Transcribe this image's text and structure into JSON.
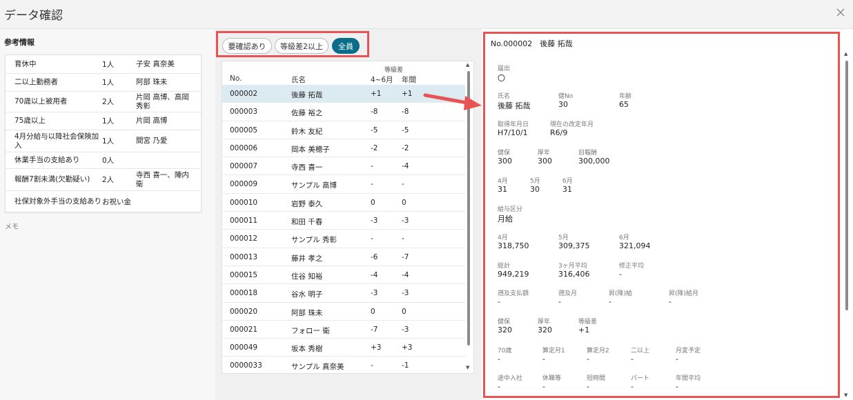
{
  "window": {
    "title": "データ確認"
  },
  "reference": {
    "heading": "参考情報",
    "rows": [
      {
        "label": "育休中",
        "count": "1人",
        "names": "子安 真奈美"
      },
      {
        "label": "二以上勤務者",
        "count": "1人",
        "names": "阿部 珠未"
      },
      {
        "label": "70歳以上被用者",
        "count": "2人",
        "names": "片岡 高博、高岡 秀彰"
      },
      {
        "label": "75歳以上",
        "count": "1人",
        "names": "片岡 高博"
      },
      {
        "label": "4月分給与以降社会保険加入",
        "count": "1人",
        "names": "間宮 乃愛"
      },
      {
        "label": "休業手当の支給あり",
        "count": "0人",
        "names": ""
      },
      {
        "label": "報酬7割未満(欠勤疑い)",
        "count": "2人",
        "names": "寺西 喜一、陣内 衛"
      },
      {
        "label": "社保対象外手当の支給あり",
        "count": "お祝い金",
        "names": ""
      }
    ],
    "memo_label": "メモ"
  },
  "filters": {
    "items": [
      "要確認あり",
      "等級差2以上",
      "全員"
    ],
    "active": "全員"
  },
  "list": {
    "header": {
      "group": "等級差",
      "no": "No.",
      "name": "氏名",
      "col_a": "4~6月",
      "col_b": "年間"
    },
    "rows": [
      {
        "no": "000002",
        "name": "後藤 拓哉",
        "a": "+1",
        "b": "+1",
        "selected": true
      },
      {
        "no": "000003",
        "name": "佐藤 裕之",
        "a": "-8",
        "b": "-8"
      },
      {
        "no": "000005",
        "name": "鈴木 友紀",
        "a": "-5",
        "b": "-5"
      },
      {
        "no": "000006",
        "name": "岡本 美穂子",
        "a": "-2",
        "b": "-2"
      },
      {
        "no": "000007",
        "name": "寺西 喜一",
        "a": "-",
        "b": "-4"
      },
      {
        "no": "000009",
        "name": "サンプル 高博",
        "a": "-",
        "b": "-"
      },
      {
        "no": "000010",
        "name": "岩野 泰久",
        "a": "0",
        "b": "0"
      },
      {
        "no": "000011",
        "name": "和田 千春",
        "a": "-3",
        "b": "-3"
      },
      {
        "no": "000012",
        "name": "サンプル 秀彰",
        "a": "-",
        "b": "-"
      },
      {
        "no": "000013",
        "name": "藤井 孝之",
        "a": "-6",
        "b": "-7"
      },
      {
        "no": "000015",
        "name": "住谷 知裕",
        "a": "-4",
        "b": "-4"
      },
      {
        "no": "000018",
        "name": "谷水 明子",
        "a": "-3",
        "b": "-3"
      },
      {
        "no": "000020",
        "name": "阿部 珠未",
        "a": "0",
        "b": "0"
      },
      {
        "no": "000021",
        "name": "フォロー 衛",
        "a": "-7",
        "b": "-3"
      },
      {
        "no": "000049",
        "name": "坂本 秀樹",
        "a": "+3",
        "b": "+3"
      },
      {
        "no": "0000033",
        "name": "サンプル 真奈美",
        "a": "-",
        "b": "-1"
      }
    ]
  },
  "detail": {
    "header": "No.000002　後藤 拓哉",
    "todokede": {
      "label": "届出",
      "value": "〇"
    },
    "name": {
      "label": "氏名",
      "value": "後藤 拓哉"
    },
    "kenno": {
      "label": "健No",
      "value": "30"
    },
    "age": {
      "label": "年齢",
      "value": "65"
    },
    "acq": {
      "label": "取得年月日",
      "value": "H7/10/1"
    },
    "revise": {
      "label": "現在の改定年月",
      "value": "R6/9"
    },
    "kenpo1": {
      "label": "健保",
      "value": "300"
    },
    "kounen1": {
      "label": "厚年",
      "value": "300"
    },
    "old_pay": {
      "label": "旧報酬",
      "value": "300,000"
    },
    "d_apr": {
      "label": "4月",
      "value": "31"
    },
    "d_may": {
      "label": "5月",
      "value": "30"
    },
    "d_jun": {
      "label": "6月",
      "value": "31"
    },
    "pay_type": {
      "label": "給与区分",
      "value": "月給"
    },
    "p_apr": {
      "label": "4月",
      "value": "318,750"
    },
    "p_may": {
      "label": "5月",
      "value": "309,375"
    },
    "p_jun": {
      "label": "6月",
      "value": "321,094"
    },
    "total": {
      "label": "総計",
      "value": "949,219"
    },
    "avg3": {
      "label": "3ヶ月平均",
      "value": "316,406"
    },
    "mod_avg": {
      "label": "修正平均",
      "value": "-"
    },
    "retro_amt": {
      "label": "遡及支払額",
      "value": "-"
    },
    "retro_month": {
      "label": "遡及月",
      "value": "-"
    },
    "raise": {
      "label": "昇(降)給",
      "value": "-"
    },
    "raise_month": {
      "label": "昇(降)給月",
      "value": "-"
    },
    "kenpo2": {
      "label": "健保",
      "value": "320"
    },
    "kounen2": {
      "label": "厚年",
      "value": "320"
    },
    "grade_diff": {
      "label": "等級差",
      "value": "+1"
    },
    "age70": {
      "label": "70歳",
      "value": "-"
    },
    "calc1": {
      "label": "算定月1",
      "value": "-"
    },
    "calc2": {
      "label": "算定月2",
      "value": "-"
    },
    "multi": {
      "label": "二以上",
      "value": "-"
    },
    "change_plan": {
      "label": "月変予定",
      "value": "-"
    },
    "midjoin": {
      "label": "途中入社",
      "value": "-"
    },
    "leave": {
      "label": "休職等",
      "value": "-"
    },
    "short": {
      "label": "短時間",
      "value": "-"
    },
    "part": {
      "label": "パート",
      "value": "-"
    },
    "annual_avg": {
      "label": "年間平均",
      "value": "-"
    }
  },
  "colors": {
    "accent": "#0a6d8a",
    "highlight": "#e85454",
    "selected_row": "#dcebf2"
  }
}
